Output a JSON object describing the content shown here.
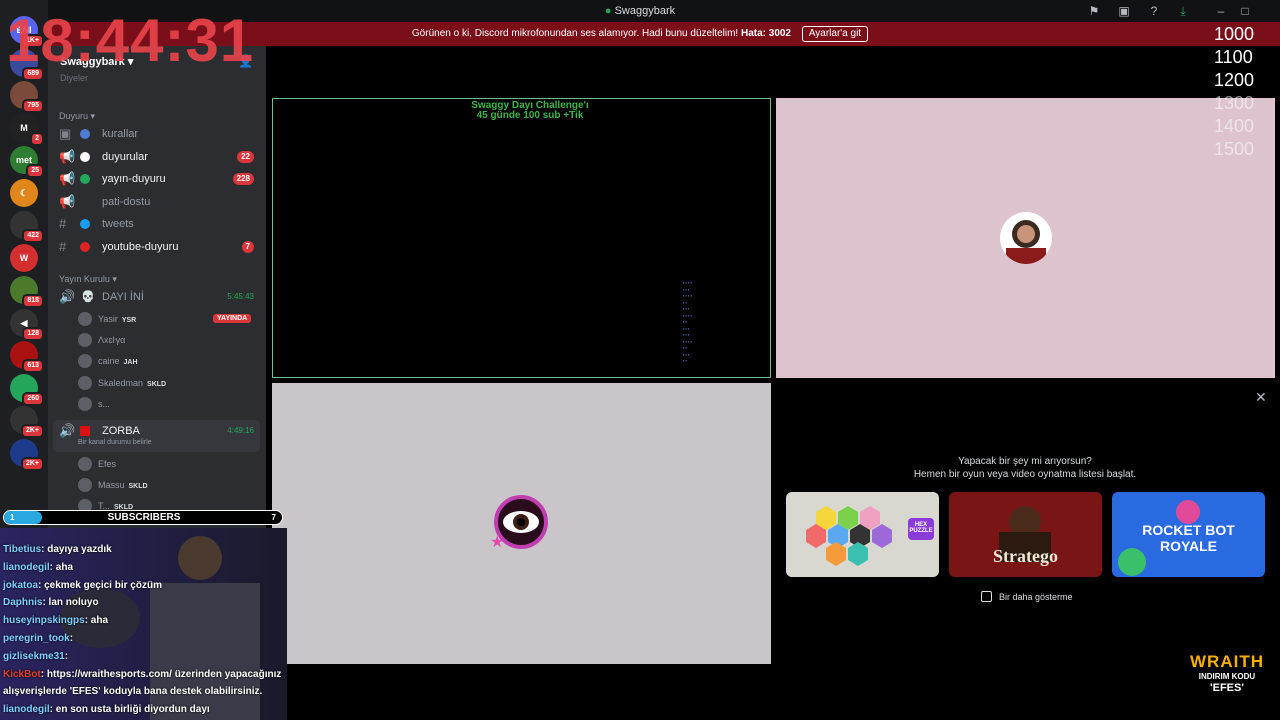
{
  "window": {
    "title": "Swaggybark"
  },
  "banner": {
    "text": "Görünen o ki, Discord mikrofonundan ses alamıyor. Hadi bunu düzeltelim!",
    "error": "Hata: 3002",
    "button": "Ayarlar'a git"
  },
  "overlay": {
    "clock": "18:44:31",
    "scale": [
      "1000",
      "1100",
      "1200",
      "1300",
      "1400",
      "1500"
    ],
    "subscribers_label": "SUBSCRIBERS",
    "sub_left": "1",
    "sub_right": "7"
  },
  "guilds": [
    {
      "label": "ENI",
      "badge": "1K+",
      "color": "#5865f2"
    },
    {
      "label": "",
      "badge": "689",
      "color": "#3b4a9c"
    },
    {
      "label": "",
      "badge": "795",
      "color": "#7a4a3a"
    },
    {
      "label": "M",
      "badge": "2",
      "color": "#222"
    },
    {
      "label": "met",
      "badge": "25",
      "color": "#2e7d32"
    },
    {
      "label": "☾",
      "badge": "",
      "color": "#e0861a"
    },
    {
      "label": "",
      "badge": "422",
      "color": "#333"
    },
    {
      "label": "W",
      "badge": "",
      "color": "#d32f2f"
    },
    {
      "label": "",
      "badge": "818",
      "color": "#4a7a2a"
    },
    {
      "label": "◀",
      "badge": "128",
      "color": "#333"
    },
    {
      "label": "",
      "badge": "613",
      "color": "#a11"
    },
    {
      "label": "",
      "badge": "260",
      "color": "#23a55a"
    },
    {
      "label": "",
      "badge": "2K+",
      "color": "#333"
    },
    {
      "label": "",
      "badge": "2K+",
      "color": "#1e3a8a"
    }
  ],
  "server": {
    "name": "Swaggybark",
    "above": "Diyeler"
  },
  "categories": {
    "duyuru": "Duyuru",
    "yayin": "Yayın Kurulu"
  },
  "channels": [
    {
      "name": "kurallar",
      "dot": "#4f7bd4",
      "count": "",
      "unread": false,
      "type": "▣"
    },
    {
      "name": "duyurular",
      "dot": "#fff",
      "count": "22",
      "unread": true,
      "type": "📢"
    },
    {
      "name": "yayın-duyuru",
      "dot": "#23a55a",
      "count": "228",
      "unread": true,
      "type": "📢"
    },
    {
      "name": "pati-dostu",
      "dot": "",
      "count": "",
      "unread": false,
      "type": "📢"
    },
    {
      "name": "tweets",
      "dot": "#1d9bf0",
      "count": "",
      "unread": false,
      "type": "#"
    },
    {
      "name": "youtube-duyuru",
      "dot": "#e02424",
      "count": "7",
      "unread": true,
      "type": "#"
    }
  ],
  "voice1": {
    "name": "DAYI İNİ",
    "time": "5:45:43",
    "live": "YAYINDA"
  },
  "voice1_users": [
    {
      "name": "Yasir",
      "tag": "YSR"
    },
    {
      "name": "Λxɛŀγα",
      "tag": ""
    },
    {
      "name": "caine",
      "tag": "JAH"
    },
    {
      "name": "Skaledman",
      "tag": "SKLD"
    },
    {
      "name": "s...",
      "tag": ""
    }
  ],
  "voice2": {
    "name": "ZORBA",
    "time": "4:49:16",
    "status": "Bir kanal durumu belirle"
  },
  "voice2_users": [
    {
      "name": "Efes",
      "tag": ""
    },
    {
      "name": "Massu",
      "tag": "SKLD"
    },
    {
      "name": "T...",
      "tag": "SKLD"
    }
  ],
  "stage": {
    "challenge_line1": "Swaggy Dayı Challenge'ı",
    "challenge_line2": "45 günde 100 sub +Tik"
  },
  "promo": {
    "line1": "Yapacak bir şey mi arıyorsun?",
    "line2": "Hemen bir oyun veya video oynatma listesi başlat.",
    "cards": [
      "HEX PUZZLE",
      "Stratego",
      "ROCKET BOT ROYALE"
    ],
    "checkbox": "Bir daha gösterme"
  },
  "chat": [
    {
      "user": "Tibetius",
      "msg": ": dayıya yazdık"
    },
    {
      "user": "lianodegil",
      "msg": ": aha"
    },
    {
      "user": "jokatoa",
      "msg": ": çekmek geçici bir çözüm"
    },
    {
      "user": "Daphnis",
      "msg": ": lan noluyo"
    },
    {
      "user": "huseyinpskingps",
      "msg": ": aha"
    },
    {
      "user": "peregrin_took",
      "msg": ": "
    },
    {
      "user": "gizlisekme31",
      "msg": ": "
    },
    {
      "user": "KickBot",
      "msg": ": https://wraithesports.com/ üzerinden yapacağınız"
    },
    {
      "user": "",
      "msg": "alışverişlerde 'EFES' koduyla bana destek olabilirsiniz."
    },
    {
      "user": "lianodegil",
      "msg": ": en son usta birliği diyordun dayı"
    }
  ],
  "sponsor": {
    "brand": "WRAITH",
    "line1": "INDIRIM KODU",
    "line2": "'EFES'"
  }
}
